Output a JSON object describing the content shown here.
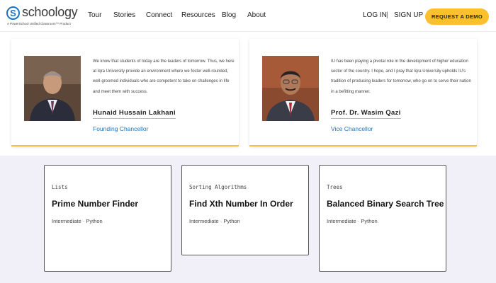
{
  "nav": {
    "logo_text": "schoology",
    "logo_mark": "S",
    "logo_tagline": "A PowerSchool Unified Classroom™ Product",
    "links": [
      "Tour",
      "Stories",
      "Connect",
      "Resources",
      "Blog",
      "About"
    ],
    "login": "LOG IN",
    "separator": "|",
    "signup": "SIGN UP",
    "cta": "REQUEST A DEMO"
  },
  "testimonials": [
    {
      "quote": "We know that students of today are the leaders of tomorrow. Thus, we here at Iqra University provide an environment where we foster well-rounded, well-groomed individuals who are competent to take on challenges in life and meet them with success.",
      "name": "Hunaid Hussain Lakhani",
      "role": "Founding Chancellor"
    },
    {
      "quote": "IU has been playing a pivotal role in the development of higher education sector of the country. I hope, and I pray that Iqra University upholds IU's tradition of producing leaders for tomorrow, who go on to serve their nation in a befitting manner.",
      "name": "Prof. Dr. Wasim Qazi",
      "role": "Vice Chancellor"
    }
  ],
  "problems": [
    {
      "category": "Lists",
      "title": "Prime Number Finder",
      "meta": "Intermediate · Python"
    },
    {
      "category": "Sorting Algorithms",
      "title": "Find Xth Number In Order",
      "meta": "Intermediate · Python"
    },
    {
      "category": "Trees",
      "title": "Balanced Binary Search Tree",
      "meta": "Intermediate · Python"
    }
  ],
  "colors": {
    "accent_yellow": "#fbc02d",
    "brand_blue": "#1e73be",
    "card_border": "#f0c040",
    "page_bg": "#f1f0f8"
  }
}
